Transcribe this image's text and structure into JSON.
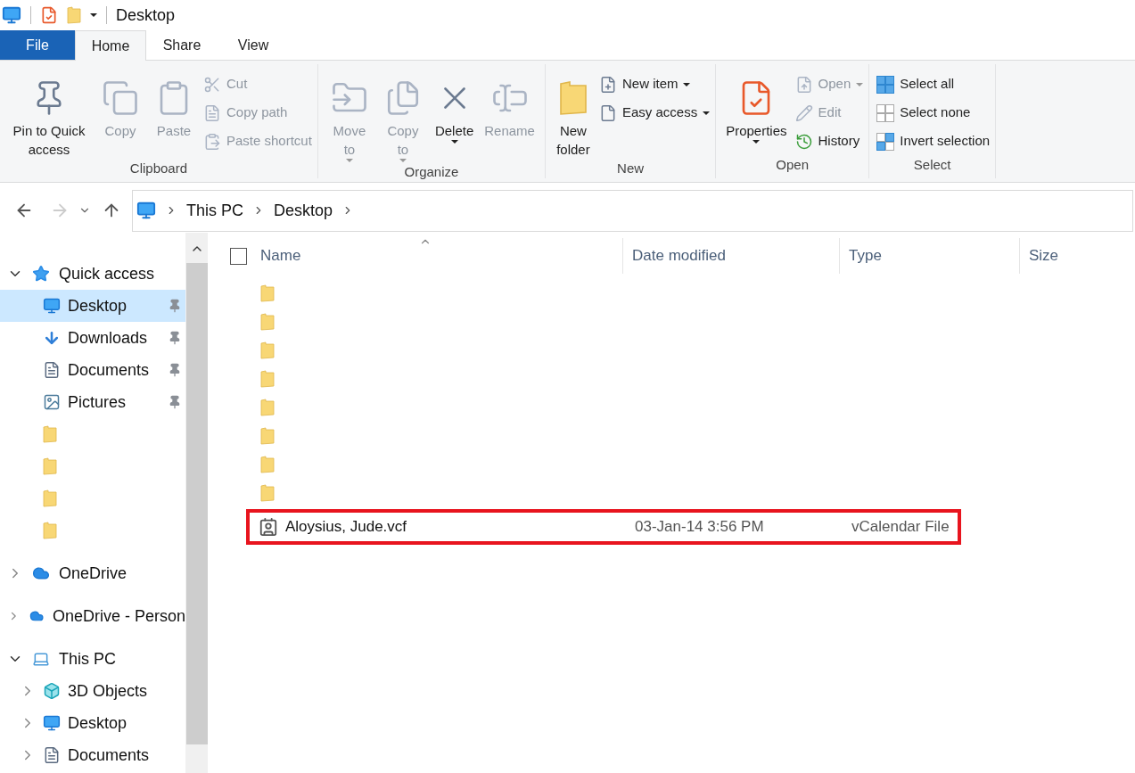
{
  "window": {
    "title": "Desktop"
  },
  "tabs": [
    {
      "label": "File",
      "kind": "file",
      "selected": false
    },
    {
      "label": "Home",
      "kind": "tab",
      "selected": true
    },
    {
      "label": "Share",
      "kind": "tab",
      "selected": false
    },
    {
      "label": "View",
      "kind": "tab",
      "selected": false
    }
  ],
  "ribbon": {
    "groups": [
      {
        "label": "Clipboard",
        "items": [
          {
            "label": "Pin to Quick access",
            "kind": "large",
            "disabled": false,
            "dropdown": false
          },
          {
            "label": "Copy",
            "kind": "large",
            "disabled": true,
            "dropdown": false
          },
          {
            "label": "Paste",
            "kind": "large",
            "disabled": true,
            "dropdown": false
          },
          {
            "label": "Cut",
            "kind": "small",
            "disabled": true,
            "dropdown": false
          },
          {
            "label": "Copy path",
            "kind": "small",
            "disabled": true,
            "dropdown": false
          },
          {
            "label": "Paste shortcut",
            "kind": "small",
            "disabled": true,
            "dropdown": false
          }
        ]
      },
      {
        "label": "Organize",
        "items": [
          {
            "label": "Move to",
            "kind": "large",
            "disabled": true,
            "dropdown": true
          },
          {
            "label": "Copy to",
            "kind": "large",
            "disabled": true,
            "dropdown": true
          },
          {
            "label": "Delete",
            "kind": "large",
            "disabled": false,
            "dropdown": true
          },
          {
            "label": "Rename",
            "kind": "large",
            "disabled": true,
            "dropdown": false
          }
        ]
      },
      {
        "label": "New",
        "items": [
          {
            "label": "New folder",
            "kind": "large",
            "disabled": false,
            "dropdown": false
          },
          {
            "label": "New item",
            "kind": "small",
            "disabled": false,
            "dropdown": true
          },
          {
            "label": "Easy access",
            "kind": "small",
            "disabled": false,
            "dropdown": true
          }
        ]
      },
      {
        "label": "Open",
        "items": [
          {
            "label": "Properties",
            "kind": "large",
            "disabled": false,
            "dropdown": true
          },
          {
            "label": "Open",
            "kind": "small",
            "disabled": true,
            "dropdown": true
          },
          {
            "label": "Edit",
            "kind": "small",
            "disabled": true,
            "dropdown": false
          },
          {
            "label": "History",
            "kind": "small",
            "disabled": false,
            "dropdown": false
          }
        ]
      },
      {
        "label": "Select",
        "items": [
          {
            "label": "Select all",
            "kind": "small",
            "disabled": false,
            "dropdown": false
          },
          {
            "label": "Select none",
            "kind": "small",
            "disabled": false,
            "dropdown": false
          },
          {
            "label": "Invert selection",
            "kind": "small",
            "disabled": false,
            "dropdown": false
          }
        ]
      }
    ]
  },
  "navigation": {
    "back_disabled": false,
    "forward_disabled": true,
    "breadcrumb": [
      "This PC",
      "Desktop"
    ]
  },
  "sidebar": {
    "items": [
      {
        "label": "Quick access",
        "kind": "star",
        "expanded": true,
        "children": [
          {
            "label": "Desktop",
            "kind": "desktop",
            "selected": true,
            "pinned": true
          },
          {
            "label": "Downloads",
            "kind": "downloads",
            "selected": false,
            "pinned": true
          },
          {
            "label": "Documents",
            "kind": "documents",
            "selected": false,
            "pinned": true
          },
          {
            "label": "Pictures",
            "kind": "pictures",
            "selected": false,
            "pinned": true
          },
          {
            "kind": "folder",
            "selected": false,
            "pinned": false
          },
          {
            "kind": "folder",
            "selected": false,
            "pinned": false
          },
          {
            "kind": "folder",
            "selected": false,
            "pinned": false
          },
          {
            "kind": "folder",
            "selected": false,
            "pinned": false
          }
        ]
      },
      {
        "label": "OneDrive",
        "kind": "cloud",
        "expanded": false
      },
      {
        "label": "OneDrive - Person",
        "kind": "cloud",
        "expanded": false
      },
      {
        "label": "This PC",
        "kind": "pc",
        "expanded": true,
        "children": [
          {
            "label": "3D Objects",
            "kind": "cube",
            "selected": false,
            "expanded": false
          },
          {
            "label": "Desktop",
            "kind": "desktop",
            "selected": false,
            "expanded": false
          },
          {
            "label": "Documents",
            "kind": "documents",
            "selected": false,
            "expanded": false
          }
        ]
      }
    ]
  },
  "file_list": {
    "select_all_checked": false,
    "columns": [
      "Name",
      "Date modified",
      "Type",
      "Size"
    ],
    "rows": [
      {
        "kind": "folder",
        "highlighted": false
      },
      {
        "kind": "folder",
        "highlighted": false
      },
      {
        "kind": "folder",
        "highlighted": false
      },
      {
        "kind": "folder",
        "highlighted": false
      },
      {
        "kind": "folder",
        "highlighted": false
      },
      {
        "kind": "folder",
        "highlighted": false
      },
      {
        "kind": "folder",
        "highlighted": false
      },
      {
        "kind": "folder",
        "highlighted": false
      },
      {
        "kind": "contact",
        "name": "Aloysius, Jude.vcf",
        "date_modified": "03-Jan-14 3:56 PM",
        "type": "vCalendar File",
        "highlighted": true
      }
    ]
  }
}
